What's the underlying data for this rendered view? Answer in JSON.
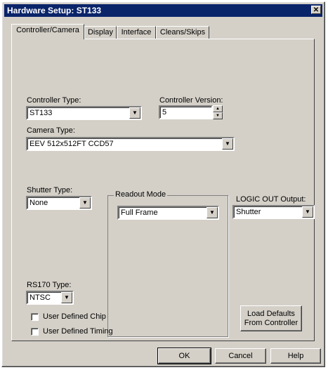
{
  "window": {
    "title": "Hardware Setup: ST133",
    "close_glyph": "✕"
  },
  "tabs": [
    {
      "label": "Controller/Camera",
      "active": true
    },
    {
      "label": "Display"
    },
    {
      "label": "Interface"
    },
    {
      "label": "Cleans/Skips"
    }
  ],
  "controller": {
    "type_label": "Controller Type:",
    "type_value": "ST133",
    "version_label": "Controller Version:",
    "version_value": "5"
  },
  "camera": {
    "type_label": "Camera Type:",
    "type_value": "EEV  512x512FT CCD57"
  },
  "shutter": {
    "label": "Shutter Type:",
    "value": "None"
  },
  "readout": {
    "label": "Readout Mode",
    "value": "Full Frame"
  },
  "logic_out": {
    "label": "LOGIC OUT Output:",
    "value": "Shutter"
  },
  "rs170": {
    "label": "RS170 Type:",
    "value": "NTSC"
  },
  "checkboxes": [
    {
      "label": "User Defined Chip",
      "checked": false
    },
    {
      "label": "User Defined Timing",
      "checked": false
    }
  ],
  "load_defaults": {
    "line1": "Load Defaults",
    "line2": "From Controller"
  },
  "footer": {
    "ok": "OK",
    "cancel": "Cancel",
    "help": "Help"
  },
  "icons": {
    "dropdown": "chevron-down-icon",
    "spin_up": "arrow-up-icon",
    "spin_down": "arrow-down-icon"
  }
}
